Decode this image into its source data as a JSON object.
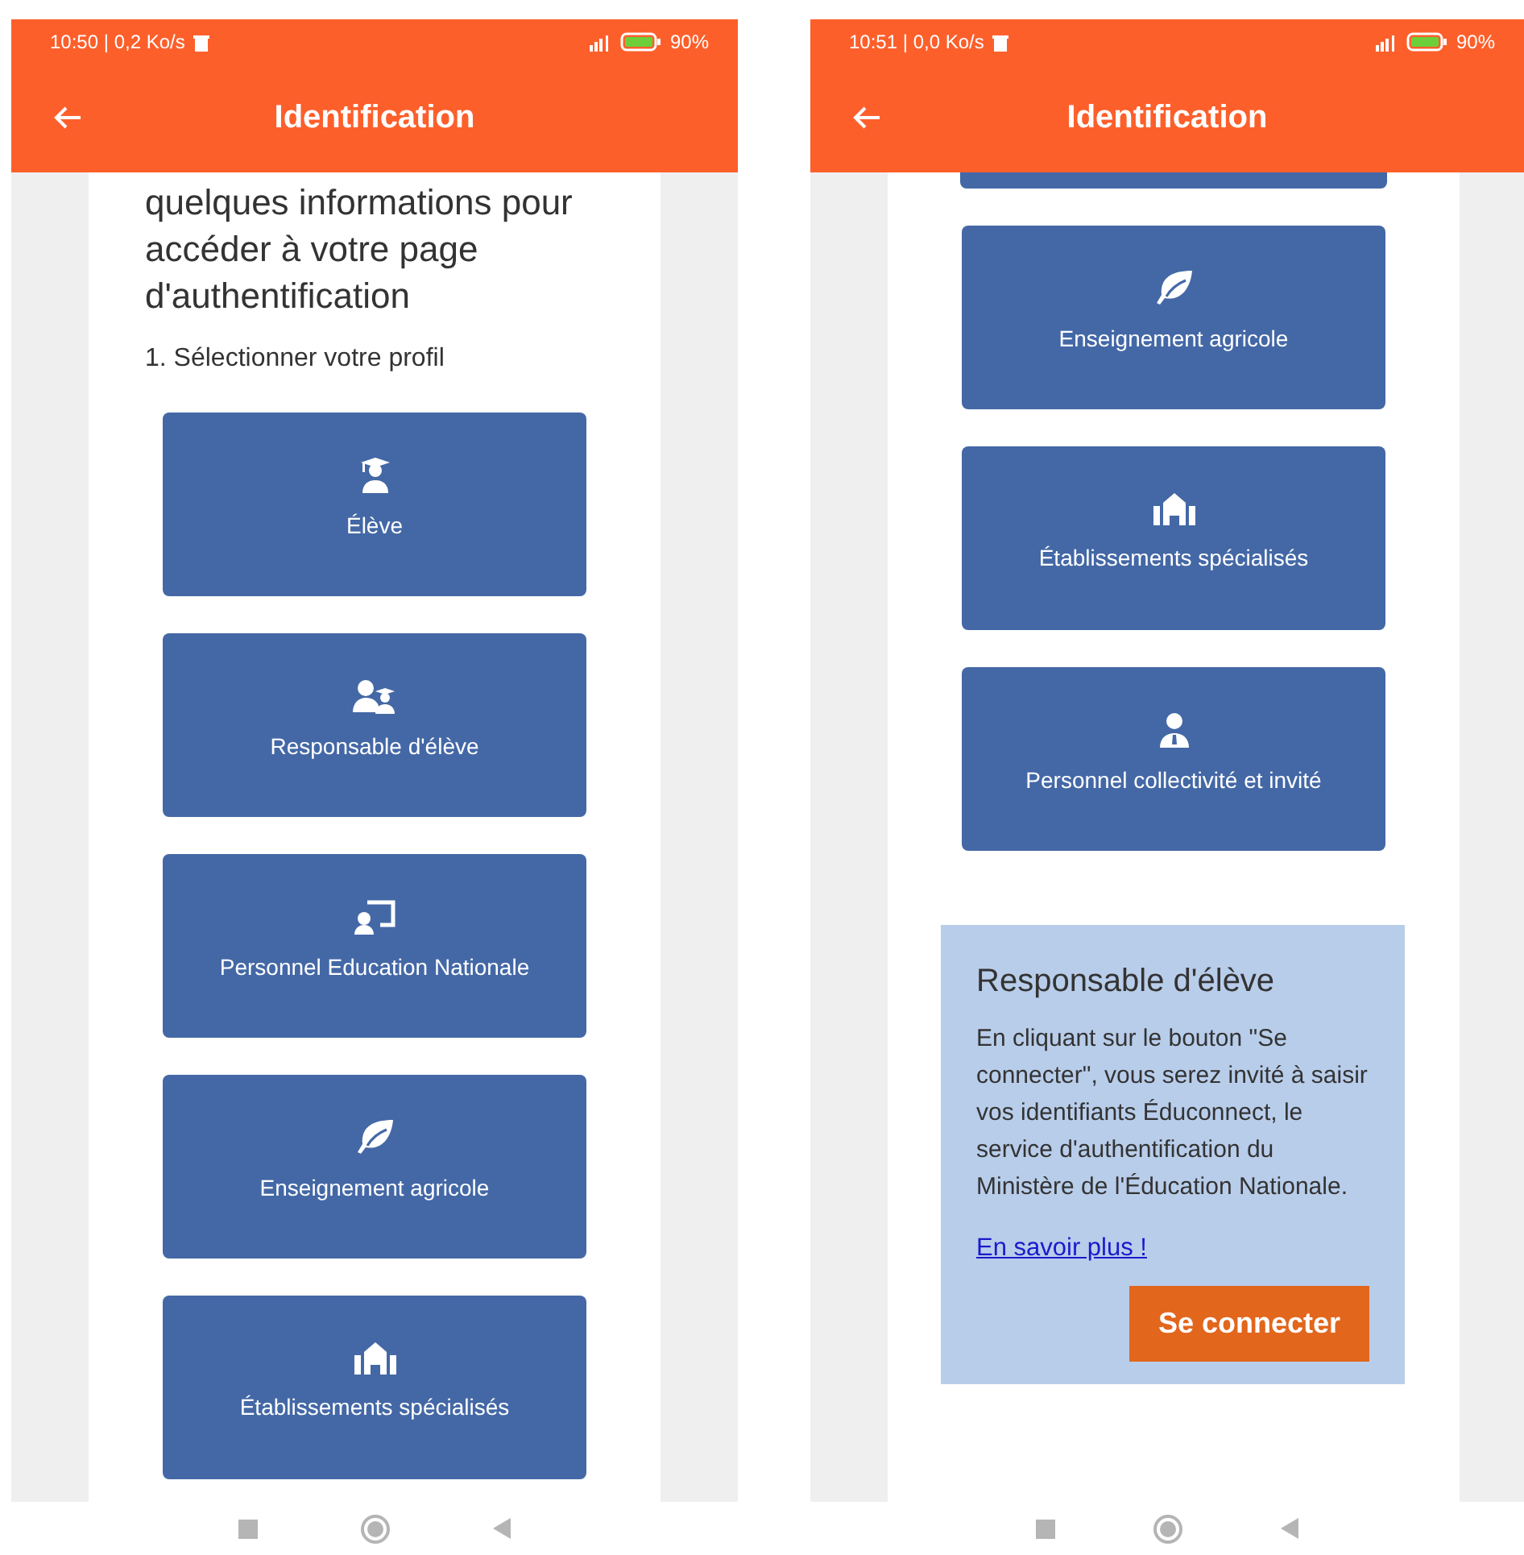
{
  "screens": [
    {
      "status_bar": {
        "status": "10:50 | 0,2 Ko/s",
        "battery": "90%"
      },
      "app_bar": {
        "title": "Identification"
      },
      "partial_card_above": false,
      "intro": {
        "heading": "quelques informations pour accéder à votre page d'authentification",
        "step": "1. Sélectionner votre profil"
      },
      "profiles": [
        {
          "label": "Élève",
          "kind": "student"
        },
        {
          "label": "Responsable d'élève",
          "kind": "parent"
        },
        {
          "label": "Personnel Education Nationale",
          "kind": "teacher"
        },
        {
          "label": "Enseignement agricole",
          "kind": "agriculture"
        },
        {
          "label": "Établissements spécialisés",
          "kind": "specialized"
        }
      ]
    },
    {
      "status_bar": {
        "status": "10:51 | 0,0 Ko/s",
        "battery": "90%"
      },
      "app_bar": {
        "title": "Identification"
      },
      "partial_card_above": true,
      "profiles": [
        {
          "label": "Enseignement agricole",
          "kind": "agriculture"
        },
        {
          "label": "Établissements spécialisés",
          "kind": "specialized"
        },
        {
          "label": "Personnel collectivité et invité",
          "kind": "staff"
        }
      ],
      "info_panel": {
        "title": "Responsable d'élève",
        "text": "En cliquant sur le bouton \"Se connecter\", vous serez invité à saisir vos identifiants Éduconnect, le service d'authentification du Ministère de l'Éducation Nationale.",
        "link": "En savoir plus !",
        "button": "Se connecter"
      }
    }
  ]
}
